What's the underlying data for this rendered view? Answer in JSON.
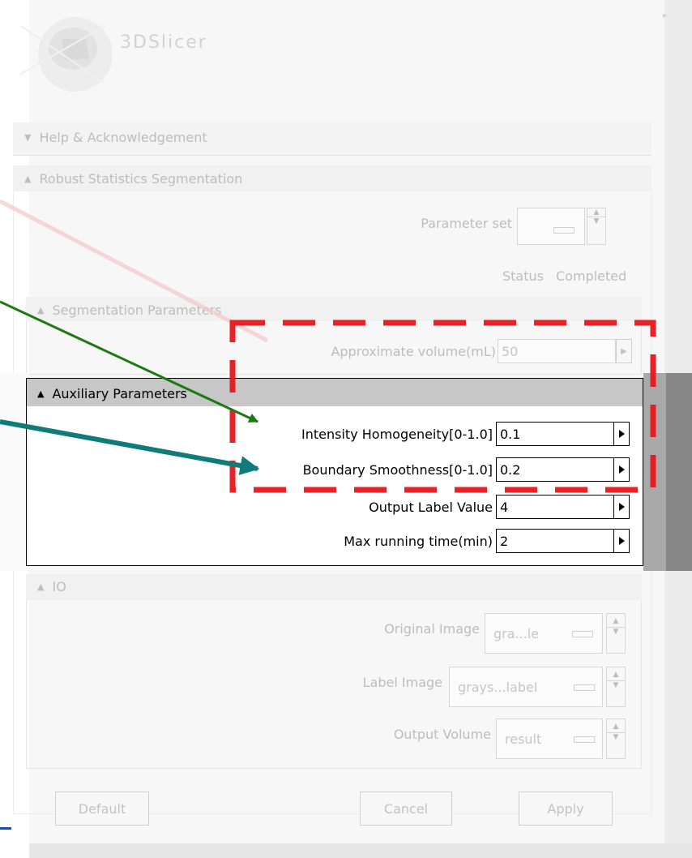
{
  "app": {
    "logo_text": "3DSlicer"
  },
  "sections": {
    "help": {
      "label": "Help & Acknowledgement"
    },
    "rss": {
      "label": "Robust Statistics Segmentation",
      "parameter_set_label": "Parameter set",
      "status_label": "Status",
      "status_value": "Completed"
    },
    "seg": {
      "label": "Segmentation Parameters",
      "approx_label": "Approximate volume(mL)",
      "approx_value": "50"
    },
    "aux": {
      "label": "Auxiliary Parameters",
      "intensity_label": "Intensity Homogeneity[0-1.0]",
      "intensity_value": "0.1",
      "boundary_label": "Boundary Smoothness[0-1.0]",
      "boundary_value": "0.2",
      "output_label_label": "Output Label Value",
      "output_label_value": "4",
      "max_time_label": "Max running time(min)",
      "max_time_value": "2"
    },
    "io": {
      "label": "IO",
      "original_label": "Original Image",
      "original_value": "gra...le",
      "labelimg_label": "Label Image",
      "labelimg_value": "grays...label",
      "output_label": "Output Volume",
      "output_value": "result"
    }
  },
  "buttons": {
    "default": "Default",
    "cancel": "Cancel",
    "apply": "Apply"
  },
  "colors": {
    "highlight_dash": "#e8161c",
    "arrow_green": "#1d7a12",
    "arrow_teal": "#0f7c7a",
    "aux_header_bg": "#c7c7c7"
  }
}
